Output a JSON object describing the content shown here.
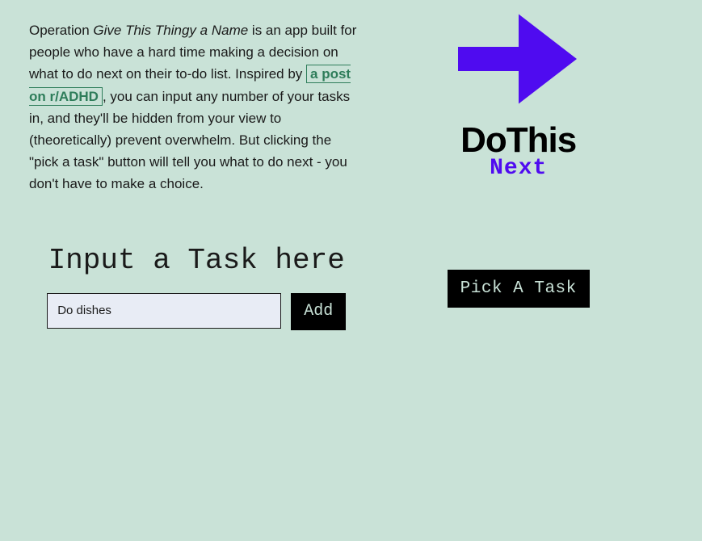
{
  "intro": {
    "prefix": "Operation ",
    "italic_name": "Give This Thingy a Name",
    "mid1": " is an app built for people who have a hard time making a decision on what to do next on their to-do list. Inspired by ",
    "link_text": "a post on r/ADHD",
    "mid2": ", you can input any number of your tasks in, and they'll be hidden from your view to (theoretically) prevent overwhelm. But clicking the \"pick a task\" button will tell you what to do next - you don't have to make a choice."
  },
  "input_section": {
    "heading": "Input a Task here",
    "placeholder": "Do dishes",
    "add_label": "Add"
  },
  "logo": {
    "main": "DoThis",
    "sub": "Next"
  },
  "pick_button_label": "Pick A Task",
  "colors": {
    "bg": "#c9e2d7",
    "accent_purple": "#4f0bf0",
    "accent_green": "#2e7d5a",
    "button_bg": "#000000"
  }
}
